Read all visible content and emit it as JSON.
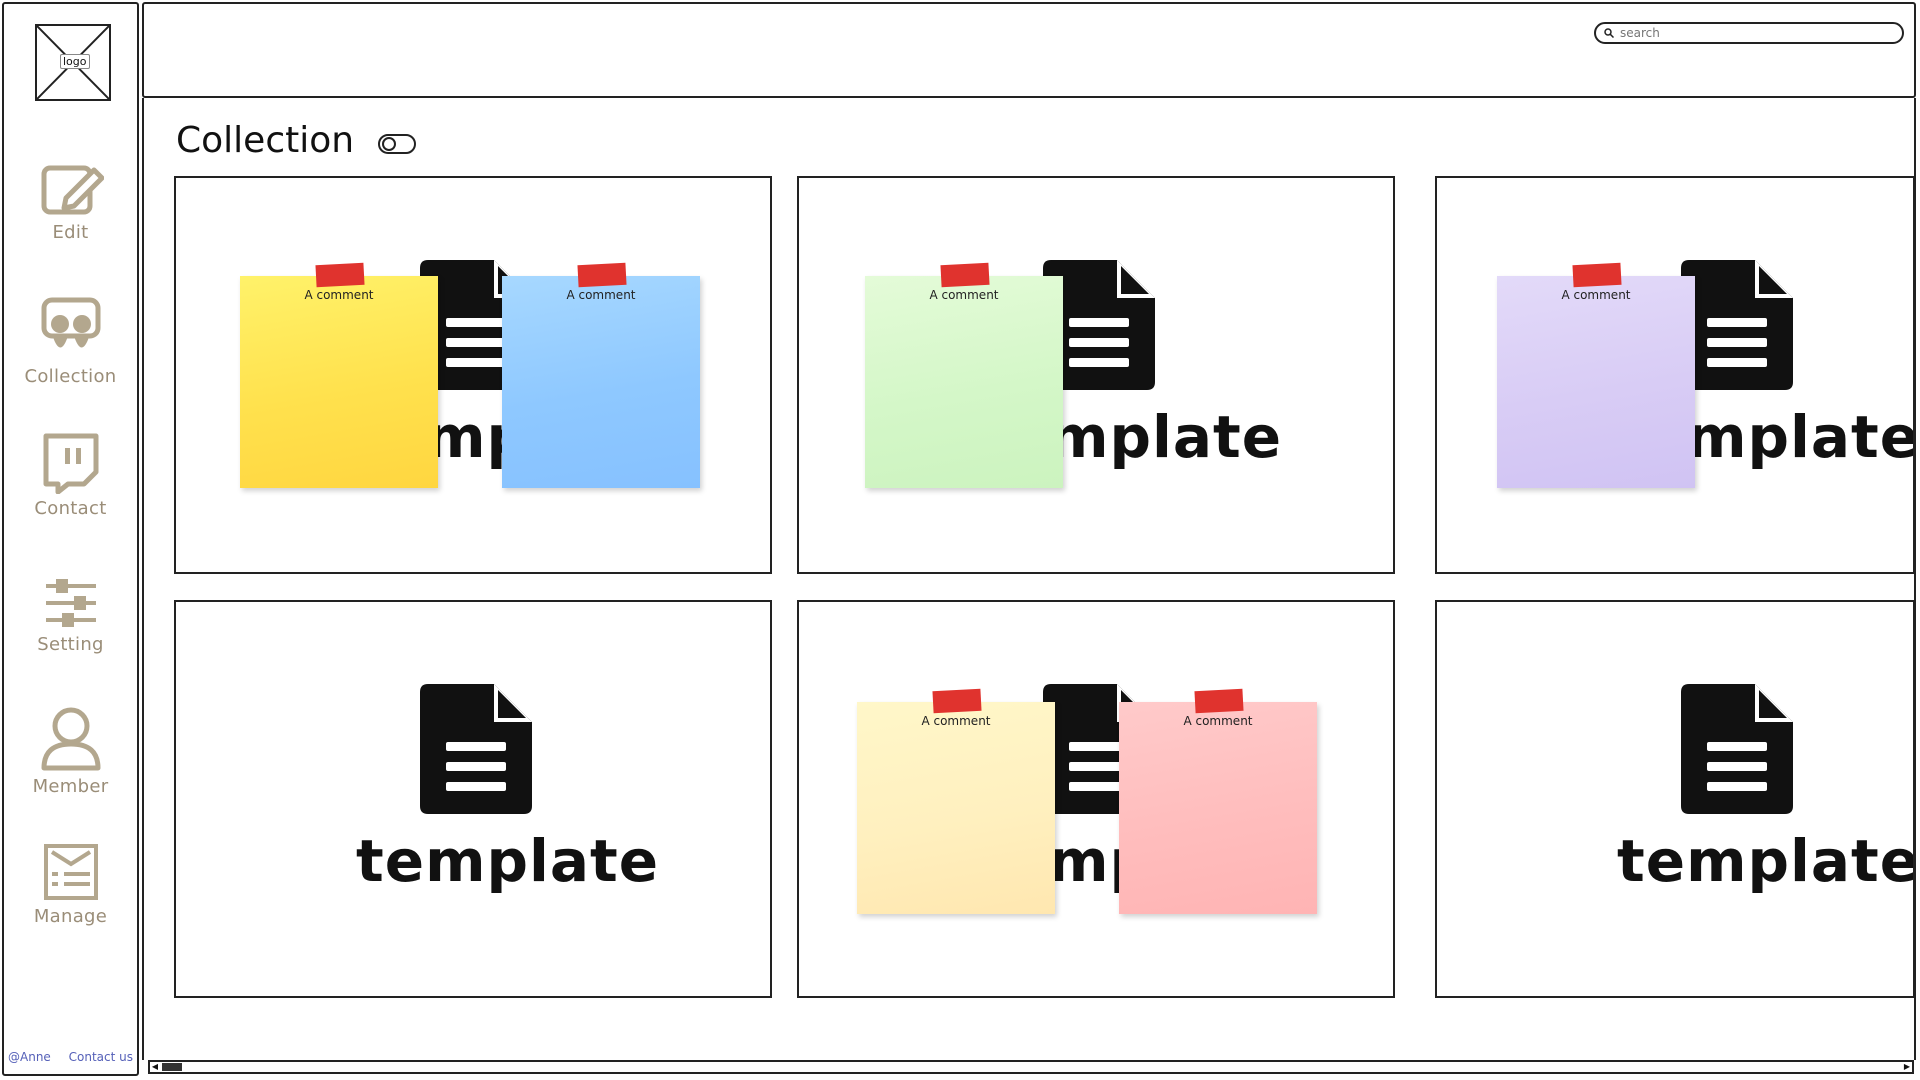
{
  "sidebar": {
    "logo_label": "logo",
    "items": [
      {
        "label": "Edit",
        "icon": "edit-icon"
      },
      {
        "label": "Collection",
        "icon": "collection-icon"
      },
      {
        "label": "Contact",
        "icon": "contact-icon"
      },
      {
        "label": "Setting",
        "icon": "setting-icon"
      },
      {
        "label": "Member",
        "icon": "member-icon"
      },
      {
        "label": "Manage",
        "icon": "manage-icon"
      }
    ],
    "footer": {
      "user": "@Anne",
      "contact": "Contact us"
    }
  },
  "header": {
    "search_placeholder": "search"
  },
  "main": {
    "title": "Collection",
    "cards": [
      {
        "label": "template",
        "notes": [
          {
            "text": "A comment",
            "color": "#ffe14d"
          },
          {
            "text": "A comment",
            "color": "#8ec8ff"
          }
        ]
      },
      {
        "label": "template",
        "notes": [
          {
            "text": "A comment",
            "color": "#d4f7c8"
          }
        ]
      },
      {
        "label": "template",
        "notes": [
          {
            "text": "A comment",
            "color": "#d8ccf5"
          }
        ]
      },
      {
        "label": "template",
        "notes": []
      },
      {
        "label": "template",
        "notes": [
          {
            "text": "A comment",
            "color": "#fff0bf"
          },
          {
            "text": "A comment",
            "color": "#ffbdbd"
          }
        ]
      },
      {
        "label": "template",
        "notes": []
      }
    ]
  },
  "colors": {
    "nav_text": "#9a8d78",
    "footer_link": "#5560b8",
    "tape": "#e0332e"
  }
}
